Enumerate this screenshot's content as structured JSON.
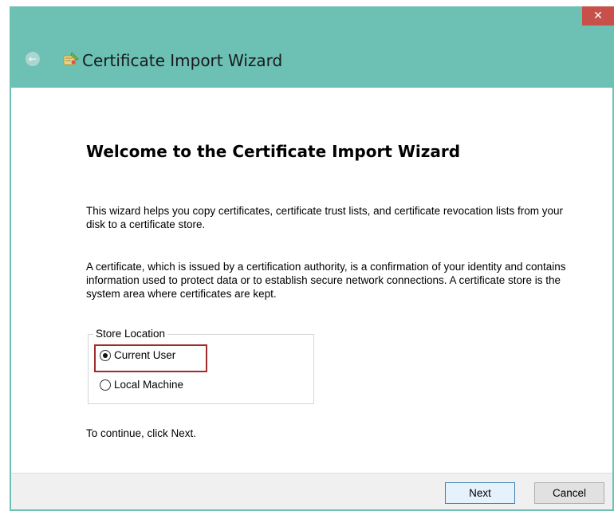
{
  "window": {
    "title": "Certificate Import Wizard",
    "close_symbol": "✕",
    "back_symbol": "←",
    "icons": {
      "back": "back-arrow-icon",
      "wizard": "certificate-wizard-icon",
      "close": "close-icon"
    },
    "colors": {
      "chrome": "#6cc0b4",
      "close": "#c7514a",
      "highlight": "#a12a2a"
    }
  },
  "content": {
    "heading": "Welcome to the Certificate Import Wizard",
    "para1": "This wizard helps you copy certificates, certificate trust lists, and certificate revocation lists from your disk to a certificate store.",
    "para2": "A certificate, which is issued by a certification authority, is a confirmation of your identity and contains information used to protect data or to establish secure network connections. A certificate store is the system area where certificates are kept.",
    "store_location": {
      "legend": "Store Location",
      "options": [
        {
          "label": "Current User",
          "checked": true
        },
        {
          "label": "Local Machine",
          "checked": false
        }
      ]
    },
    "continue_text": "To continue, click Next."
  },
  "footer": {
    "next_label": "Next",
    "cancel_label": "Cancel"
  }
}
